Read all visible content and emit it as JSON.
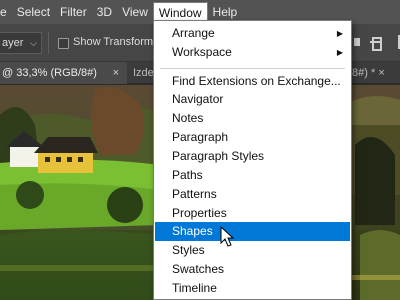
{
  "menubar": {
    "items": [
      "Select",
      "Filter",
      "3D",
      "View",
      "Window",
      "Help"
    ],
    "partial_left": "e",
    "open_item": "Window"
  },
  "options_bar": {
    "layer_select": "ayer",
    "show_transform": "Show Transform C"
  },
  "tabs": {
    "active": "@ 33,3% (RGB/8#)",
    "close_glyph": "×",
    "second": "Izde",
    "third": "/8#) *",
    "third_close": "×"
  },
  "window_menu": {
    "items": [
      {
        "label": "Arrange",
        "submenu": true
      },
      {
        "label": "Workspace",
        "submenu": true
      },
      {
        "label": "Find Extensions on Exchange..."
      },
      {
        "label": "Navigator"
      },
      {
        "label": "Notes"
      },
      {
        "label": "Paragraph"
      },
      {
        "label": "Paragraph Styles"
      },
      {
        "label": "Paths"
      },
      {
        "label": "Patterns"
      },
      {
        "label": "Properties"
      },
      {
        "label": "Shapes",
        "highlighted": true
      },
      {
        "label": "Styles"
      },
      {
        "label": "Swatches"
      },
      {
        "label": "Timeline"
      }
    ],
    "highlight_color": "#0078d7"
  },
  "colors": {
    "menubar_bg": "#535353",
    "options_bg": "#464646",
    "tab_active_bg": "#4a4a4a",
    "highlight": "#0078d7"
  }
}
